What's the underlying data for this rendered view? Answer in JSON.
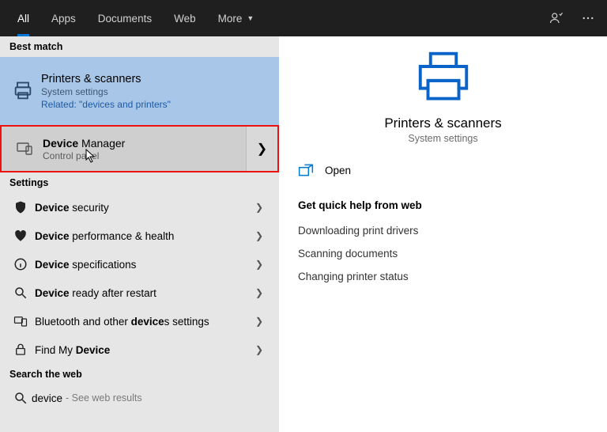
{
  "topbar": {
    "tabs": {
      "all": "All",
      "apps": "Apps",
      "documents": "Documents",
      "web": "Web",
      "more": "More"
    }
  },
  "left": {
    "best_match_label": "Best match",
    "best": {
      "title": "Printers & scanners",
      "subtitle": "System settings",
      "related": "Related: \"devices and printers\""
    },
    "highlighted": {
      "title_prefix": "Device",
      "title_rest": " Manager",
      "subtitle": "Control panel"
    },
    "settings_label": "Settings",
    "rows": [
      {
        "prefix": "Device",
        "rest": " security"
      },
      {
        "prefix": "Device",
        "rest": " performance & health"
      },
      {
        "prefix": "Device",
        "rest": " specifications"
      },
      {
        "prefix": "Device",
        "rest": " ready after restart"
      },
      {
        "prefix_text": "Bluetooth and other ",
        "bold": "device",
        "suffix": "s settings"
      },
      {
        "prefix_text": "Find My ",
        "bold": "Device",
        "suffix": ""
      }
    ],
    "search_web_label": "Search the web",
    "search": {
      "query": "device",
      "hint": "- See web results"
    }
  },
  "right": {
    "hero": {
      "title": "Printers & scanners",
      "subtitle": "System settings"
    },
    "action_open": "Open",
    "quick_help_heading": "Get quick help from web",
    "quick_help": {
      "a": "Downloading print drivers",
      "b": "Scanning documents",
      "c": "Changing printer status"
    }
  }
}
